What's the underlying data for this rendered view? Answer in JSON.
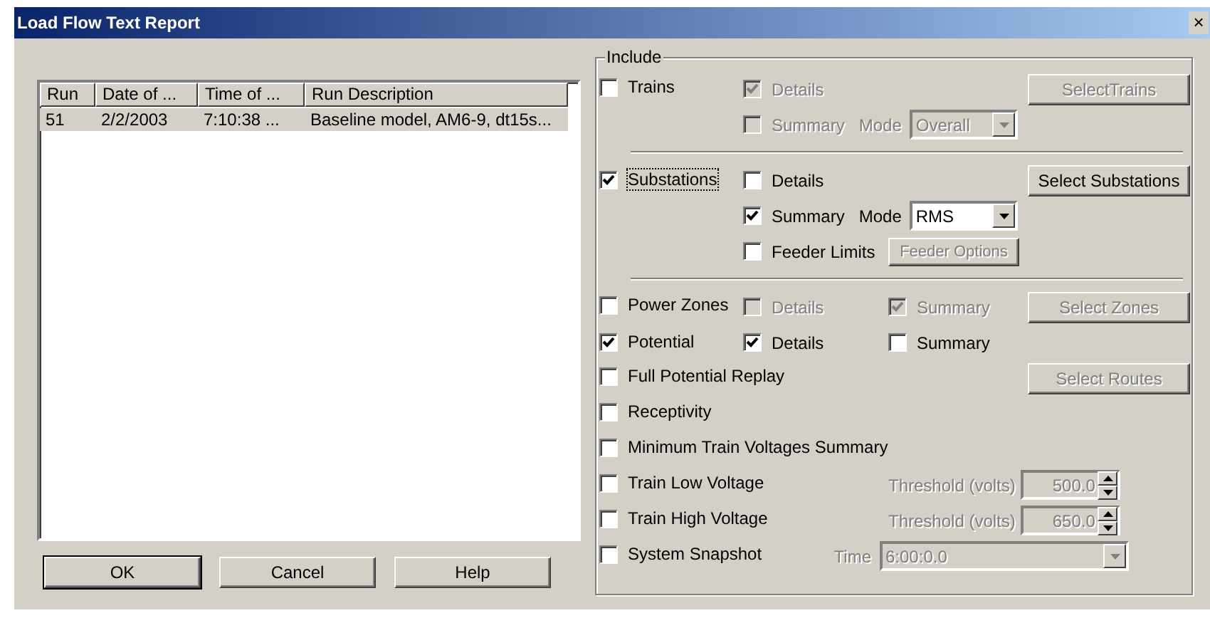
{
  "window": {
    "title": "Load Flow Text Report",
    "close": "×"
  },
  "runs": {
    "columns": [
      "Run",
      "Date of ...",
      "Time of ...",
      "Run Description"
    ],
    "rows": [
      {
        "cells": [
          "51",
          "2/2/2003",
          "7:10:38 ...",
          "Baseline model, AM6-9, dt15s..."
        ],
        "selected": true
      }
    ]
  },
  "buttons": [
    {
      "label": "OK",
      "default": true
    },
    {
      "label": "Cancel",
      "default": false
    },
    {
      "label": "Help",
      "default": false
    }
  ],
  "include": {
    "title": "Include",
    "sections": [
      [
        {
          "main": {
            "label": "Trains",
            "checked": false
          },
          "options": [
            {
              "kind": "checkbox",
              "label": "Details",
              "checked": true,
              "disabled": true
            }
          ],
          "action": {
            "label": "SelectTrains",
            "disabled": true
          }
        },
        {
          "options": [
            {
              "kind": "mode",
              "label": "Summary",
              "checked": false,
              "disabled": true,
              "mode_label": "Mode",
              "value": "Overall"
            }
          ]
        }
      ],
      [
        {
          "main": {
            "label": "Substations",
            "checked": true,
            "focused": true
          },
          "options": [
            {
              "kind": "checkbox",
              "label": "Details",
              "checked": false,
              "disabled": false
            }
          ],
          "action": {
            "label": "Select Substations",
            "disabled": false
          }
        },
        {
          "options": [
            {
              "kind": "mode",
              "label": "Summary",
              "checked": true,
              "disabled": false,
              "mode_label": "Mode",
              "value": "RMS"
            }
          ]
        },
        {
          "options": [
            {
              "kind": "checkbox",
              "label": "Feeder Limits",
              "checked": false,
              "disabled": false
            },
            {
              "kind": "button",
              "label": "Feeder Options",
              "disabled": true
            }
          ]
        }
      ],
      [
        {
          "main": {
            "label": "Power Zones",
            "checked": false
          },
          "options": [
            {
              "kind": "checkbox",
              "label": "Details",
              "checked": false,
              "disabled": true
            },
            {
              "kind": "checkbox",
              "label": "Summary",
              "checked": true,
              "disabled": true
            }
          ],
          "action": {
            "label": "Select Zones",
            "disabled": true
          }
        },
        {
          "main": {
            "label": "Potential",
            "checked": true
          },
          "options": [
            {
              "kind": "checkbox",
              "label": "Details",
              "checked": true,
              "disabled": false
            },
            {
              "kind": "checkbox",
              "label": "Summary",
              "checked": false,
              "disabled": false
            }
          ]
        },
        {
          "main": {
            "label": "Full Potential Replay",
            "checked": false
          },
          "action": {
            "label": "Select Routes",
            "disabled": true
          }
        },
        {
          "main": {
            "label": "Receptivity",
            "checked": false
          }
        },
        {
          "main": {
            "label": "Minimum Train Voltages Summary",
            "checked": false
          }
        },
        {
          "main": {
            "label": "Train Low Voltage",
            "checked": false
          },
          "options": [
            {
              "kind": "spin",
              "label": "Threshold (volts)",
              "value": "500.0",
              "disabled": true
            }
          ]
        },
        {
          "main": {
            "label": "Train High Voltage",
            "checked": false
          },
          "options": [
            {
              "kind": "spin",
              "label": "Threshold (volts)",
              "value": "650.0",
              "disabled": true
            }
          ]
        },
        {
          "main": {
            "label": "System Snapshot",
            "checked": false
          },
          "options": [
            {
              "kind": "time",
              "label": "Time",
              "value": "6:00:0.0",
              "disabled": true
            }
          ]
        }
      ]
    ]
  }
}
